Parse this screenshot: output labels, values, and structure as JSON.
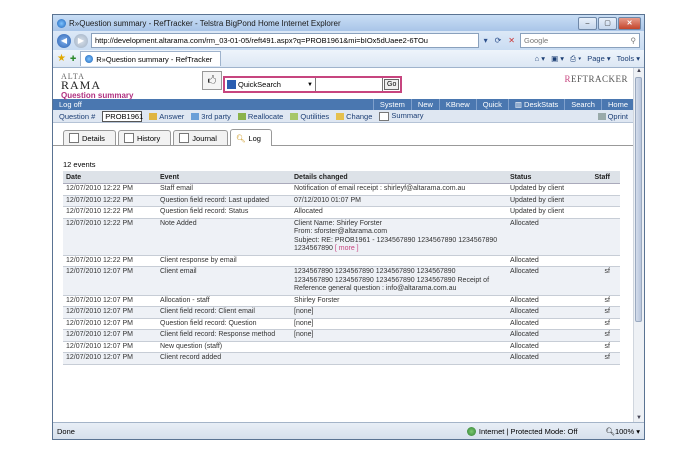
{
  "window": {
    "title": "R»Question summary - RefTracker - Telstra BigPond Home Internet Explorer",
    "url": "http://development.altarama.com/rm_03-01-05/reft491.aspx?q=PROB1961&mi=bIOx5dUaee2-6TOu",
    "search_placeholder": "Google",
    "tab_label": "R»Question summary - RefTracker",
    "page_menu": "Page",
    "tools_menu": "Tools",
    "status_left": "Done",
    "status_zone": "Internet | Protected Mode: Off",
    "zoom": "100%"
  },
  "app": {
    "logo_line1": "ALTA",
    "logo_line2": "RAMA",
    "page_title": "Question summary",
    "search_type": "QuickSearch",
    "search_value": "",
    "go_label": "Go",
    "brand_prefix": "R",
    "brand_rest": "EFTRACKER",
    "logoff": "Log off",
    "nav": [
      "System",
      "New",
      "KBnew",
      "Quick",
      "DeskStats",
      "Search",
      "Home"
    ],
    "question_label": "Question #",
    "question_number": "PROB1961",
    "tools": [
      "Answer",
      "3rd party",
      "Reallocate",
      "Qutilities",
      "Change",
      "Summary"
    ],
    "print_label": "Qprint",
    "tabs": [
      "Details",
      "History",
      "Journal",
      "Log"
    ],
    "events_count": "12 events"
  },
  "log_table": {
    "headers": [
      "Date",
      "Event",
      "Details changed",
      "Status",
      "Staff"
    ],
    "rows": [
      {
        "date": "12/07/2010 12:22 PM",
        "event": "Staff email",
        "details": "Notification of email receipt : shirleyf@altarama.com.au",
        "status": "Updated by client",
        "staff": ""
      },
      {
        "date": "12/07/2010 12:22 PM",
        "event": "Question field record: Last updated",
        "details": "07/12/2010 01:07 PM",
        "status": "Updated by client",
        "staff": ""
      },
      {
        "date": "12/07/2010 12:22 PM",
        "event": "Question field record: Status",
        "details": "Allocated",
        "status": "Updated by client",
        "staff": ""
      },
      {
        "date": "12/07/2010 12:22 PM",
        "event": "Note Added",
        "details": "Client Name: Shirley Forster\nFrom: sforster@altarama.com\nSubject: RE: PROB1961 - 1234567890 1234567890 1234567890 1234567890",
        "more": "[ more ]",
        "status": "Allocated",
        "staff": ""
      },
      {
        "date": "12/07/2010 12:22 PM",
        "event": "Client response by email",
        "details": "",
        "status": "Allocated",
        "staff": ""
      },
      {
        "date": "12/07/2010 12:07 PM",
        "event": "Client email",
        "details": "1234567890 1234567890 1234567890 1234567890\n1234567890 1234567890 1234567890 1234567890 Receipt of\nReference general question : info@altarama.com.au",
        "status": "Allocated",
        "staff": "sf"
      },
      {
        "date": "12/07/2010 12:07 PM",
        "event": "Allocation - staff",
        "details": "Shirley Forster",
        "status": "Allocated",
        "staff": "sf"
      },
      {
        "date": "12/07/2010 12:07 PM",
        "event": "Client field record: Client email",
        "details": "[none]",
        "status": "Allocated",
        "staff": "sf"
      },
      {
        "date": "12/07/2010 12:07 PM",
        "event": "Question field record: Question",
        "details": "[none]",
        "status": "Allocated",
        "staff": "sf"
      },
      {
        "date": "12/07/2010 12:07 PM",
        "event": "Client field record: Response method",
        "details": "[none]",
        "status": "Allocated",
        "staff": "sf"
      },
      {
        "date": "12/07/2010 12:07 PM",
        "event": "New question (staff)",
        "details": "",
        "status": "Allocated",
        "staff": "sf"
      },
      {
        "date": "12/07/2010 12:07 PM",
        "event": "Client record added",
        "details": "",
        "status": "Allocated",
        "staff": "sf"
      }
    ]
  },
  "colors": {
    "accent": "#c7457f",
    "nav_bg": "#4a77b0",
    "toolbar_bg": "#dfe7f2"
  }
}
